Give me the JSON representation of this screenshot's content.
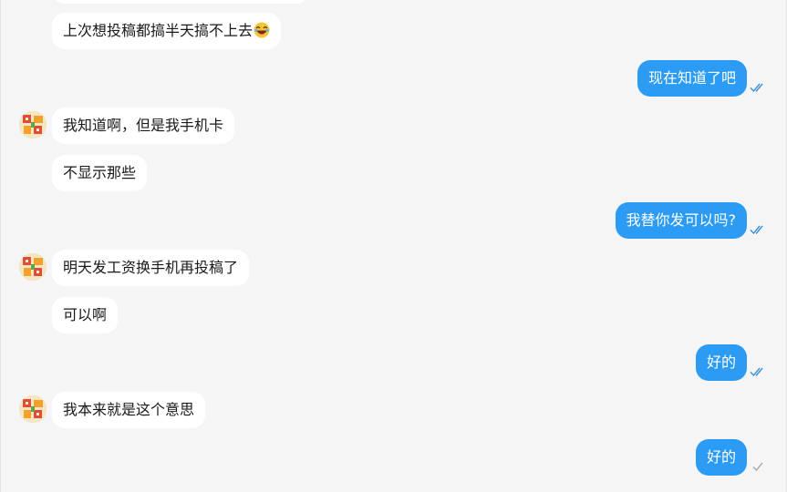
{
  "messages": [
    {
      "dir": "in",
      "text": "上次想投稿都搞半天搞不上去",
      "emoji": "laughing-face-icon"
    },
    {
      "dir": "out",
      "text": "现在知道了吧",
      "status": "read"
    },
    {
      "dir": "in",
      "text": "我知道啊，但是我手机卡",
      "avatar": true
    },
    {
      "dir": "in",
      "text": "不显示那些"
    },
    {
      "dir": "out",
      "text": "我替你发可以吗?",
      "status": "read"
    },
    {
      "dir": "in",
      "text": "明天发工资换手机再投稿了",
      "avatar": true
    },
    {
      "dir": "in",
      "text": "可以啊"
    },
    {
      "dir": "out",
      "text": "好的",
      "status": "read"
    },
    {
      "dir": "in",
      "text": "我本来就是这个意思",
      "avatar": true
    },
    {
      "dir": "out",
      "text": "好的",
      "status": "sent"
    }
  ],
  "colors": {
    "outgoing_bubble": "#2b9bf3",
    "incoming_bubble": "#ffffff",
    "read_tick": "#3a8fd8",
    "sent_tick": "#a8a8a8",
    "background": "#f5f5f5"
  }
}
